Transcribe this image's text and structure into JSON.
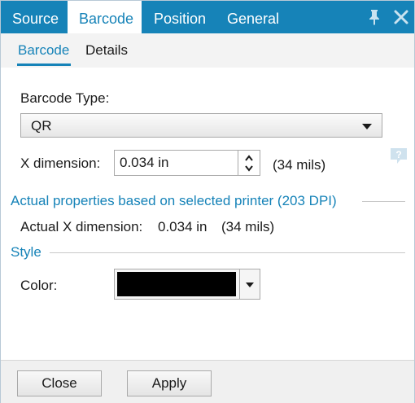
{
  "top_tabs": [
    "Source",
    "Barcode",
    "Position",
    "General"
  ],
  "sub_tabs": [
    "Barcode",
    "Details"
  ],
  "barcode_type": {
    "label": "Barcode Type:",
    "value": "QR"
  },
  "x_dimension": {
    "label": "X dimension:",
    "value": "0.034 in",
    "mils": "(34 mils)"
  },
  "actual": {
    "header": "Actual properties based on selected printer (203 DPI)",
    "label": "Actual X dimension:",
    "value": "0.034 in",
    "mils": "(34 mils)"
  },
  "style": {
    "header": "Style",
    "color_label": "Color:",
    "color_value": "#000000"
  },
  "buttons": {
    "close": "Close",
    "apply": "Apply"
  },
  "colors": {
    "accent": "#1683b8"
  }
}
